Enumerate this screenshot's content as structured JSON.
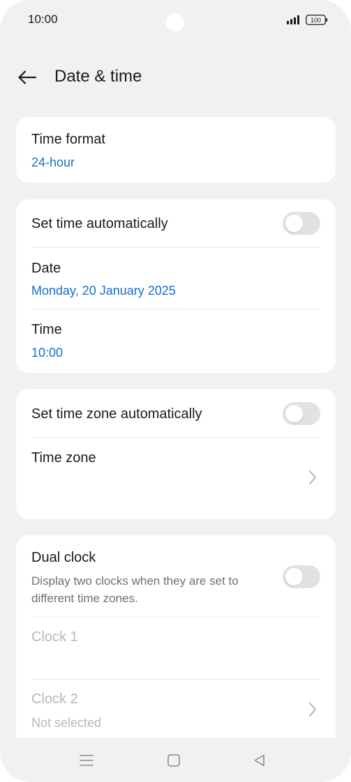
{
  "status_bar": {
    "time": "10:00",
    "battery": "100"
  },
  "header": {
    "title": "Date & time"
  },
  "time_format": {
    "label": "Time format",
    "value": "24-hour"
  },
  "set_time_auto": {
    "label": "Set time automatically",
    "enabled": false
  },
  "date": {
    "label": "Date",
    "value": "Monday, 20 January 2025"
  },
  "time": {
    "label": "Time",
    "value": "10:00"
  },
  "set_zone_auto": {
    "label": "Set time zone automatically",
    "enabled": false
  },
  "time_zone": {
    "label": "Time zone"
  },
  "dual_clock": {
    "label": "Dual clock",
    "description": "Display two clocks when they are set to different time zones.",
    "enabled": false
  },
  "clock1": {
    "label": "Clock 1"
  },
  "clock2": {
    "label": "Clock 2",
    "value": "Not selected"
  },
  "colors": {
    "accent": "#1a6fc9",
    "background": "#f1f1f3",
    "card": "#ffffff",
    "toggle_off": "#e2e2e4",
    "disabled_text": "#b7b7b7"
  },
  "icons": {
    "back": "arrow-left-icon",
    "chevron": "chevron-right-icon",
    "nav_menu": "menu-icon",
    "nav_home": "square-home-icon",
    "nav_back": "triangle-back-icon"
  }
}
